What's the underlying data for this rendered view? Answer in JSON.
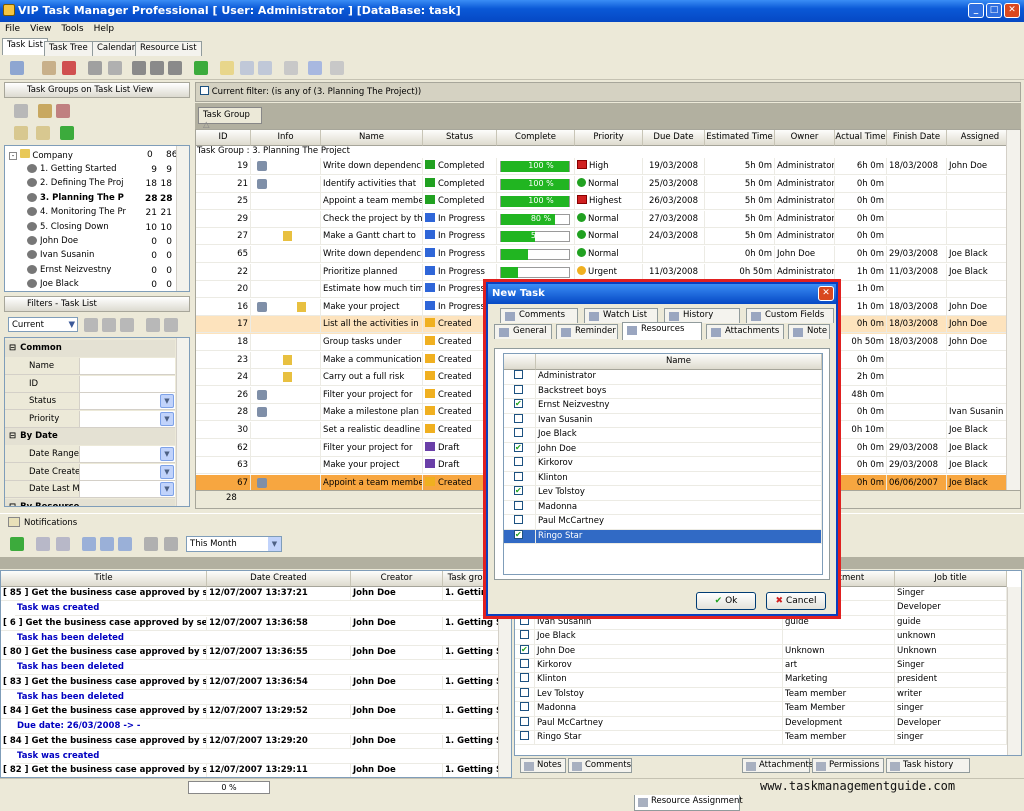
{
  "window": {
    "title": "VIP Task Manager Professional [ User: Administrator ] [DataBase: task]"
  },
  "menu": [
    "File",
    "View",
    "Tools",
    "Help"
  ],
  "main_tabs": [
    "Task List",
    "Task Tree",
    "Calendar",
    "Resource List"
  ],
  "task_groups": {
    "title": "Task Groups on Task List View",
    "root": "Company",
    "root_a": "0",
    "root_b": "86",
    "items": [
      {
        "label": "1. Getting Started",
        "a": "9",
        "b": "9",
        "bold": false
      },
      {
        "label": "2. Defining The Proj",
        "a": "18",
        "b": "18",
        "bold": false
      },
      {
        "label": "3. Planning The P",
        "a": "28",
        "b": "28",
        "bold": true
      },
      {
        "label": "4. Monitoring The Pr",
        "a": "21",
        "b": "21",
        "bold": false
      },
      {
        "label": "5. Closing Down",
        "a": "10",
        "b": "10",
        "bold": false
      },
      {
        "label": "John Doe",
        "a": "0",
        "b": "0",
        "bold": false
      },
      {
        "label": "Ivan Susanin",
        "a": "0",
        "b": "0",
        "bold": false
      },
      {
        "label": "Ernst Neizvestny",
        "a": "0",
        "b": "0",
        "bold": false
      },
      {
        "label": "Joe Black",
        "a": "0",
        "b": "0",
        "bold": false
      }
    ]
  },
  "filters": {
    "title": "Filters - Task List",
    "current": "Current",
    "sections": [
      {
        "header": "Common",
        "items": [
          "Name",
          "ID",
          "Status",
          "Priority"
        ]
      },
      {
        "header": "By Date",
        "items": [
          "Date Range",
          "Date Create",
          "Date Last M"
        ]
      },
      {
        "header": "By Resource",
        "items": []
      }
    ]
  },
  "filter_bar": {
    "text": "Current filter:  (is any of (3. Planning The Project))",
    "group_by": "Task Group"
  },
  "task_grid": {
    "columns": [
      "ID",
      "Info",
      "Name",
      "Status",
      "Complete",
      "Priority",
      "Due Date",
      "Estimated Time",
      "Owner",
      "Actual Time",
      "Finish Date",
      "Assigned"
    ],
    "group_row": "Task Group : 3. Planning The Project",
    "rows": [
      {
        "id": "19",
        "name": "Write down dependencies",
        "status": "Completed",
        "pct": 100,
        "pct_label": "100 %",
        "priority": "High",
        "due": "19/03/2008",
        "est": "5h 0m",
        "owner": "Administrator",
        "actual": "6h 0m",
        "finish": "18/03/2008",
        "assigned": "John Doe"
      },
      {
        "id": "21",
        "name": "Identify activities that",
        "status": "Completed",
        "pct": 100,
        "pct_label": "100 %",
        "priority": "Normal",
        "due": "25/03/2008",
        "est": "5h 0m",
        "owner": "Administrator",
        "actual": "0h 0m",
        "finish": "",
        "assigned": ""
      },
      {
        "id": "25",
        "name": "Appoint a team member",
        "status": "Completed",
        "pct": 100,
        "pct_label": "100 %",
        "priority": "Highest",
        "due": "26/03/2008",
        "est": "5h 0m",
        "owner": "Administrator",
        "actual": "0h 0m",
        "finish": "",
        "assigned": ""
      },
      {
        "id": "29",
        "name": "Check the project by the",
        "status": "In Progress",
        "pct": 80,
        "pct_label": "80 %",
        "priority": "Normal",
        "due": "27/03/2008",
        "est": "5h 0m",
        "owner": "Administrator",
        "actual": "0h 0m",
        "finish": "",
        "assigned": ""
      },
      {
        "id": "27",
        "name": "Make a Gantt chart to",
        "status": "In Progress",
        "pct": 50,
        "pct_label": "50 %",
        "priority": "Normal",
        "due": "24/03/2008",
        "est": "5h 0m",
        "owner": "Administrator",
        "actual": "0h 0m",
        "finish": "",
        "assigned": ""
      },
      {
        "id": "65",
        "name": "Write down dependencies",
        "status": "In Progress",
        "pct": 40,
        "pct_label": "40 %",
        "priority": "Normal",
        "due": "",
        "est": "0h 0m",
        "owner": "John Doe",
        "actual": "0h 0m",
        "finish": "29/03/2008",
        "assigned": "Joe Black"
      },
      {
        "id": "22",
        "name": "Prioritize planned",
        "status": "In Progress",
        "pct": 25,
        "pct_label": "25 %",
        "priority": "Urgent",
        "due": "11/03/2008",
        "est": "0h 50m",
        "owner": "Administrator",
        "actual": "1h 0m",
        "finish": "11/03/2008",
        "assigned": "Joe Black"
      },
      {
        "id": "20",
        "name": "Estimate how much time",
        "status": "In Progress",
        "pct": 0,
        "pct_label": "",
        "priority": "",
        "due": "",
        "est": "",
        "owner": "",
        "actual": "1h 0m",
        "finish": "",
        "assigned": ""
      },
      {
        "id": "16",
        "name": "Make your project",
        "status": "In Progress",
        "pct": 0,
        "pct_label": "",
        "priority": "",
        "due": "",
        "est": "",
        "owner": "",
        "actual": "1h 0m",
        "finish": "18/03/2008",
        "assigned": "John Doe"
      },
      {
        "id": "17",
        "name": "List all the activities in",
        "status": "Created",
        "pct": 0,
        "pct_label": "",
        "priority": "",
        "due": "",
        "est": "",
        "owner": "",
        "actual": "0h 0m",
        "finish": "18/03/2008",
        "assigned": "John Doe"
      },
      {
        "id": "18",
        "name": "Group tasks under",
        "status": "Created",
        "pct": 0,
        "pct_label": "",
        "priority": "",
        "due": "",
        "est": "",
        "owner": "",
        "actual": "0h 50m",
        "finish": "18/03/2008",
        "assigned": "John Doe"
      },
      {
        "id": "23",
        "name": "Make a communication",
        "status": "Created",
        "pct": 0,
        "pct_label": "",
        "priority": "",
        "due": "",
        "est": "",
        "owner": "",
        "actual": "0h 0m",
        "finish": "",
        "assigned": ""
      },
      {
        "id": "24",
        "name": "Carry out a full risk",
        "status": "Created",
        "pct": 0,
        "pct_label": "",
        "priority": "",
        "due": "",
        "est": "",
        "owner": "",
        "actual": "2h 0m",
        "finish": "",
        "assigned": ""
      },
      {
        "id": "26",
        "name": "Filter your project for",
        "status": "Created",
        "pct": 0,
        "pct_label": "",
        "priority": "",
        "due": "",
        "est": "",
        "owner": "",
        "actual": "48h 0m",
        "finish": "",
        "assigned": ""
      },
      {
        "id": "28",
        "name": "Make a milestone plan for",
        "status": "Created",
        "pct": 0,
        "pct_label": "",
        "priority": "",
        "due": "",
        "est": "",
        "owner": "",
        "actual": "0h 0m",
        "finish": "",
        "assigned": "Ivan Susanin"
      },
      {
        "id": "30",
        "name": "Set a realistic deadline for",
        "status": "Created",
        "pct": 0,
        "pct_label": "",
        "priority": "",
        "due": "",
        "est": "",
        "owner": "",
        "actual": "0h 10m",
        "finish": "",
        "assigned": "Joe Black"
      },
      {
        "id": "62",
        "name": "Filter your project for",
        "status": "Draft",
        "pct": 0,
        "pct_label": "",
        "priority": "",
        "due": "",
        "est": "",
        "owner": "",
        "actual": "0h 0m",
        "finish": "29/03/2008",
        "assigned": "Joe Black"
      },
      {
        "id": "63",
        "name": "Make your project",
        "status": "Draft",
        "pct": 0,
        "pct_label": "",
        "priority": "",
        "due": "",
        "est": "",
        "owner": "",
        "actual": "0h 0m",
        "finish": "29/03/2008",
        "assigned": "Joe Black"
      },
      {
        "id": "67",
        "name": "Appoint a team member",
        "status": "Created",
        "pct": 0,
        "pct_label": "",
        "priority": "",
        "due": "",
        "est": "",
        "owner": "",
        "actual": "0h 0m",
        "finish": "06/06/2007",
        "assigned": "Joe Black"
      }
    ],
    "footer_count": "28"
  },
  "notifications": {
    "title": "Notifications",
    "period": "This Month",
    "columns": [
      "Title",
      "Date Created",
      "Creator",
      "Task group"
    ],
    "rows": [
      {
        "title": "[ 85 ] Get the business case approved by sen",
        "date": "12/07/2007 13:37:21",
        "creator": "John Doe",
        "group": "1. Getting",
        "sub": "Task was created"
      },
      {
        "title": "[ 6 ] Get the business case approved by senio",
        "date": "12/07/2007 13:36:58",
        "creator": "John Doe",
        "group": "1. Getting St",
        "sub": "Task has been deleted"
      },
      {
        "title": "[ 80 ] Get the business case approved by sen",
        "date": "12/07/2007 13:36:55",
        "creator": "John Doe",
        "group": "1. Getting St",
        "sub": "Task has been deleted"
      },
      {
        "title": "[ 83 ] Get the business case approved by sen",
        "date": "12/07/2007 13:36:54",
        "creator": "John Doe",
        "group": "1. Getting St",
        "sub": "Task has been deleted"
      },
      {
        "title": "[ 84 ] Get the business case approved by sen",
        "date": "12/07/2007 13:29:52",
        "creator": "John Doe",
        "group": "1. Getting St",
        "sub": "Due date: 26/03/2008 -> -"
      },
      {
        "title": "[ 84 ] Get the business case approved by sen",
        "date": "12/07/2007 13:29:20",
        "creator": "John Doe",
        "group": "1. Getting St",
        "sub": "Task was created"
      },
      {
        "title": "[ 82 ] Get the business case approved by sen",
        "date": "12/07/2007 13:29:11",
        "creator": "John Doe",
        "group": "1. Getting St",
        "sub": ""
      }
    ]
  },
  "resources_panel": {
    "columns": [
      "",
      "Name",
      "Department",
      "Job title"
    ],
    "rows": [
      {
        "name": "",
        "dept": "",
        "job": "Singer",
        "on": false
      },
      {
        "name": "",
        "dept": "",
        "job": "Developer",
        "on": false
      },
      {
        "name": "Ivan Susanin",
        "dept": "guide",
        "job": "guide",
        "on": false
      },
      {
        "name": "Joe Black",
        "dept": "",
        "job": "unknown",
        "on": false
      },
      {
        "name": "John Doe",
        "dept": "Unknown",
        "job": "Unknown",
        "on": true
      },
      {
        "name": "Kirkorov",
        "dept": "art",
        "job": "Singer",
        "on": false
      },
      {
        "name": "Klinton",
        "dept": "Marketing",
        "job": "president",
        "on": false
      },
      {
        "name": "Lev Tolstoy",
        "dept": "Team member",
        "job": "writer",
        "on": false
      },
      {
        "name": "Madonna",
        "dept": "Team Member",
        "job": "singer",
        "on": false
      },
      {
        "name": "Paul McCartney",
        "dept": "Development",
        "job": "Developer",
        "on": false
      },
      {
        "name": "Ringo Star",
        "dept": "Team member",
        "job": "singer",
        "on": false
      }
    ],
    "tabs": [
      "Notes",
      "Comments",
      "Resource Assignment",
      "Attachments",
      "Permissions",
      "Task history"
    ]
  },
  "dialog": {
    "title": "New Task",
    "tabs_row1": [
      "Comments",
      "Watch List",
      "History",
      "Custom Fields"
    ],
    "tabs_row2": [
      "General",
      "Reminder",
      "Resources",
      "Attachments",
      "Note"
    ],
    "col_name": "Name",
    "resources": [
      {
        "name": "Administrator",
        "on": false
      },
      {
        "name": "Backstreet boys",
        "on": false
      },
      {
        "name": "Ernst Neizvestny",
        "on": true
      },
      {
        "name": "Ivan Susanin",
        "on": false
      },
      {
        "name": "Joe Black",
        "on": false
      },
      {
        "name": "John Doe",
        "on": true
      },
      {
        "name": "Kirkorov",
        "on": false
      },
      {
        "name": "Klinton",
        "on": false
      },
      {
        "name": "Lev Tolstoy",
        "on": true
      },
      {
        "name": "Madonna",
        "on": false
      },
      {
        "name": "Paul McCartney",
        "on": false
      },
      {
        "name": "Ringo Star",
        "on": true,
        "selected": true
      }
    ],
    "ok": "Ok",
    "cancel": "Cancel"
  },
  "status": {
    "progress": "0 %",
    "watermark": "www.taskmanagementguide.com"
  },
  "colors": {
    "accent": "#316ac5",
    "highlight_row": "#f7a640",
    "progress": "#21b521"
  }
}
